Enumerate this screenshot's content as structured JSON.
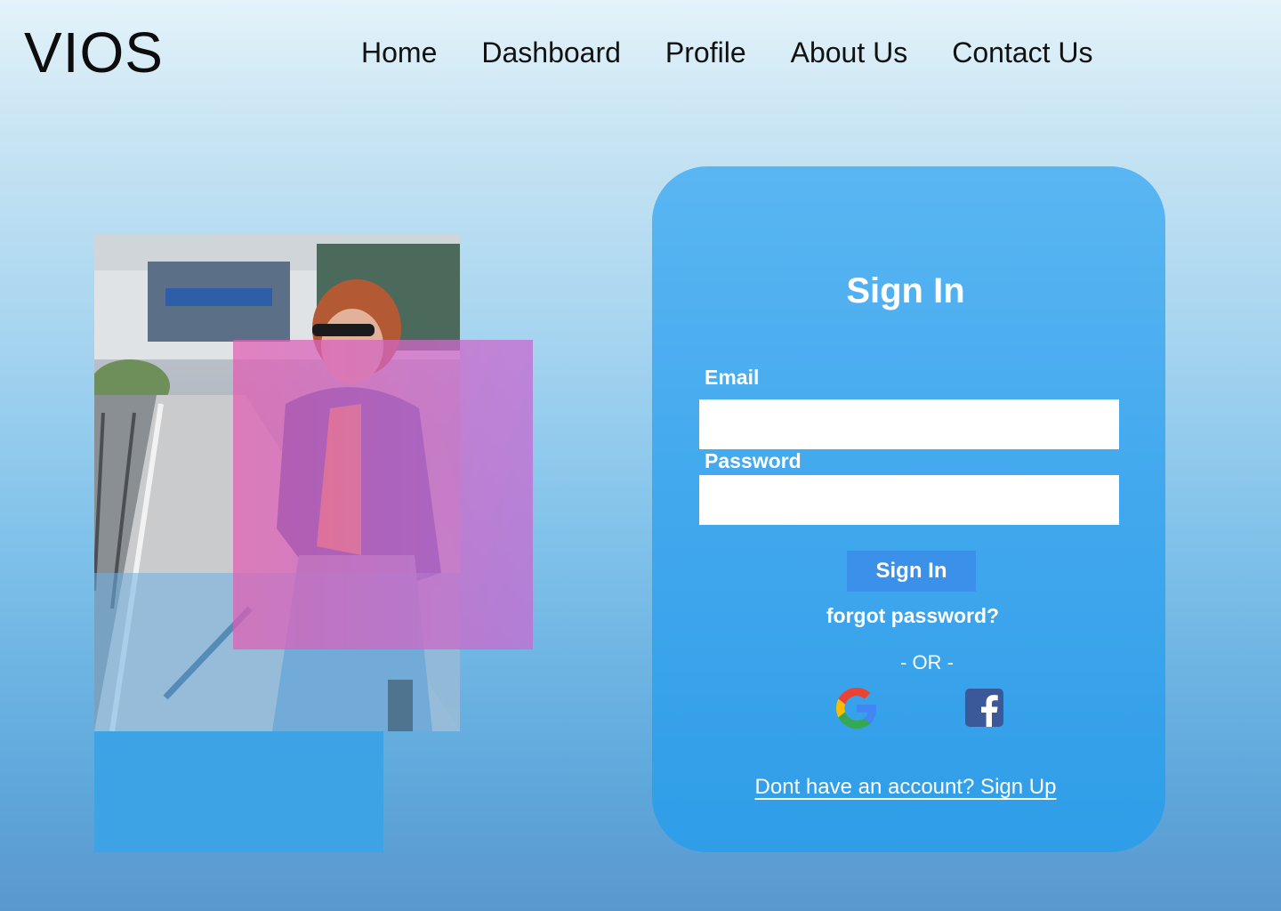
{
  "header": {
    "logo": "VIOS",
    "nav": [
      {
        "label": "Home"
      },
      {
        "label": "Dashboard"
      },
      {
        "label": "Profile"
      },
      {
        "label": "About Us"
      },
      {
        "label": "Contact Us"
      }
    ]
  },
  "signin": {
    "title": "Sign In",
    "email_label": "Email",
    "email_value": "",
    "password_label": "Password",
    "password_value": "",
    "submit_label": "Sign In",
    "forgot_label": "forgot password?",
    "or_label": "- OR -",
    "social": [
      {
        "icon": "google-icon"
      },
      {
        "icon": "facebook-icon"
      }
    ],
    "signup_label": "Dont have an account? Sign Up"
  },
  "colors": {
    "card": "#43a9ee",
    "button": "#3b90ea",
    "overlay_pink": "#d45fc0",
    "overlay_blue": "#3ea3e4"
  }
}
